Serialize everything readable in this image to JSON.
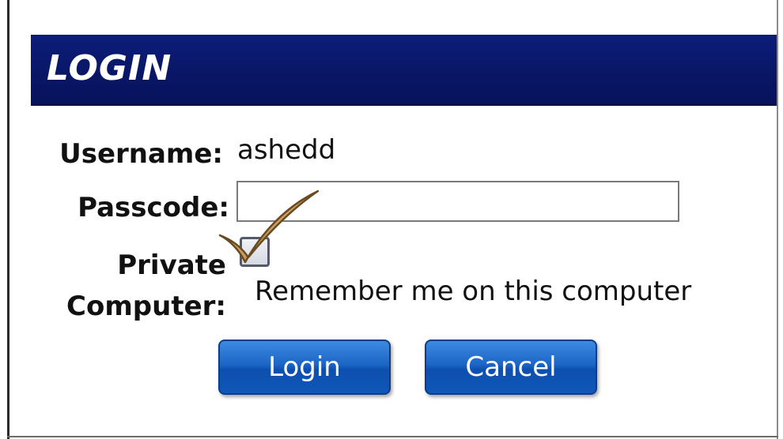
{
  "header": {
    "title": "LOGIN"
  },
  "form": {
    "username_label": "Username:",
    "username_value": "ashedd",
    "passcode_label": "Passcode:",
    "passcode_value": "",
    "private_label_line1": "Private",
    "private_label_line2": "Computer:",
    "remember_text": "Remember me on this computer",
    "remember_checked": false
  },
  "buttons": {
    "login_label": "Login",
    "cancel_label": "Cancel"
  },
  "colors": {
    "header_bg": "#091665",
    "button_bg": "#1c66c6",
    "checkmark": "#c99a5a"
  },
  "icons": {
    "annotation": "checkmark-icon"
  }
}
